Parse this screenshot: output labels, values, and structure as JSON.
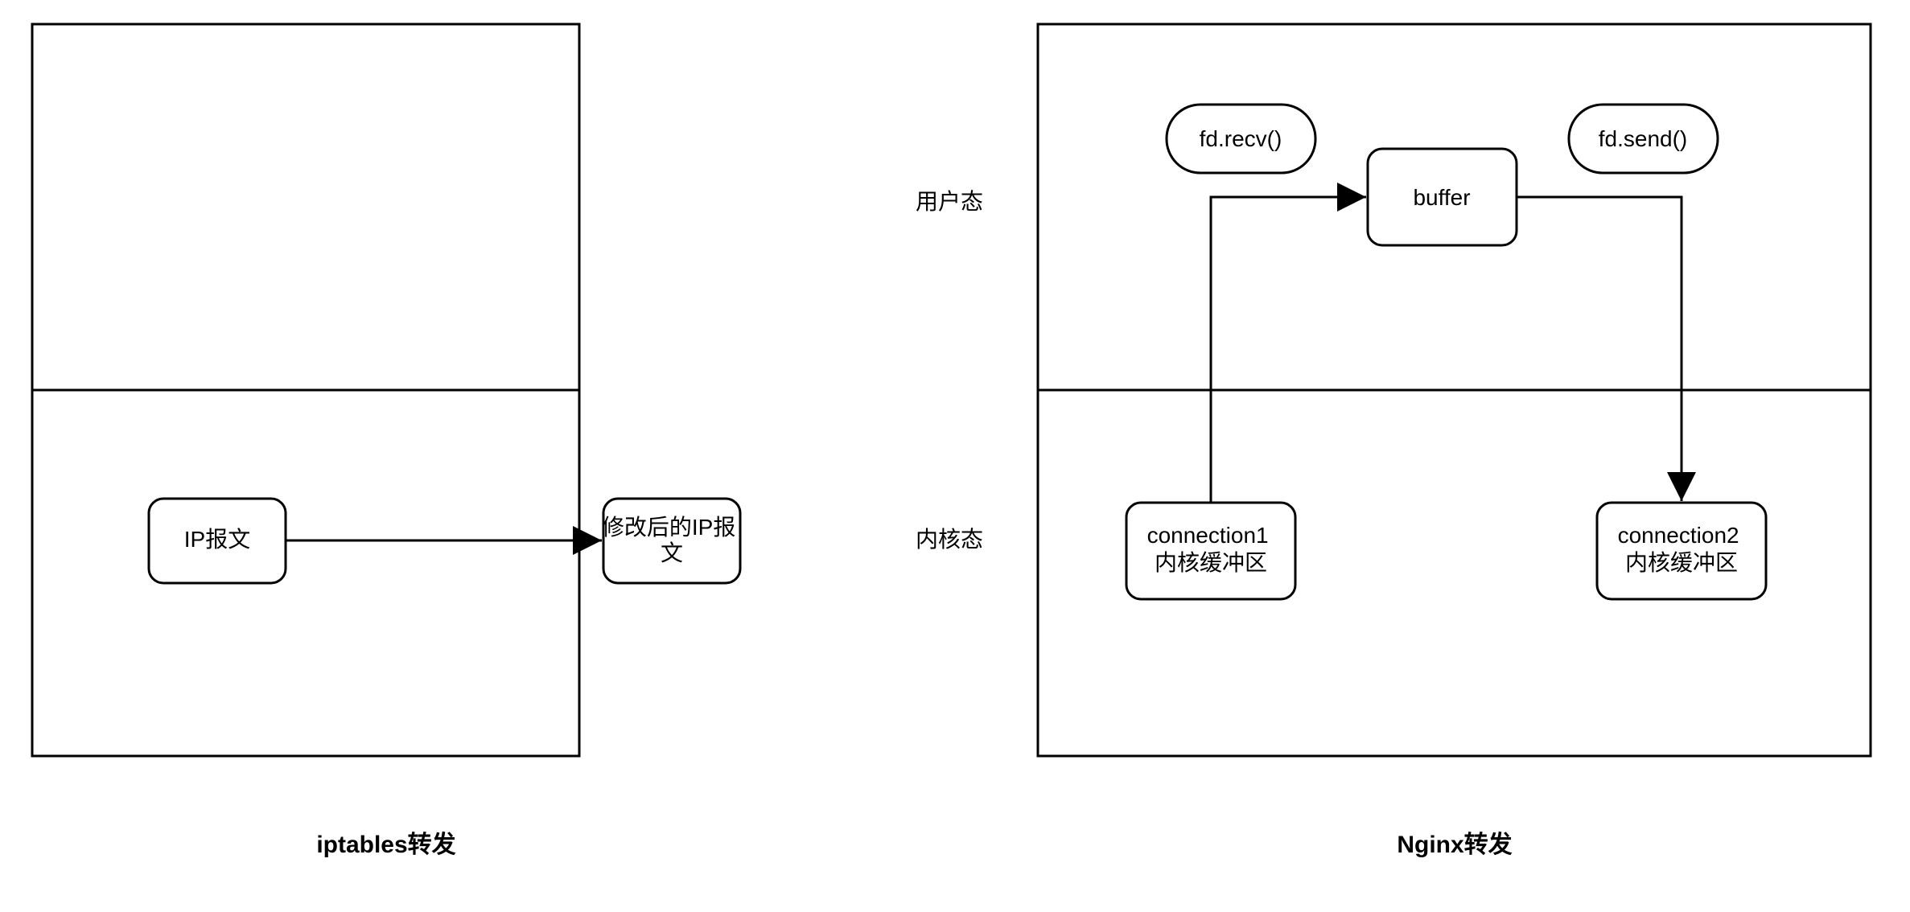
{
  "labels": {
    "user_space": "用户态",
    "kernel_space": "内核态"
  },
  "left": {
    "caption": "iptables转发",
    "ip_packet": "IP报文",
    "modified_ip_packet": "修改后的IP报\n文"
  },
  "right": {
    "caption": "Nginx转发",
    "fd_recv": "fd.recv()",
    "fd_send": "fd.send()",
    "buffer": "buffer",
    "connection1_line1": "connection1",
    "connection1_line2": "内核缓冲区",
    "connection2_line1": "connection2",
    "connection2_line2": "内核缓冲区"
  }
}
